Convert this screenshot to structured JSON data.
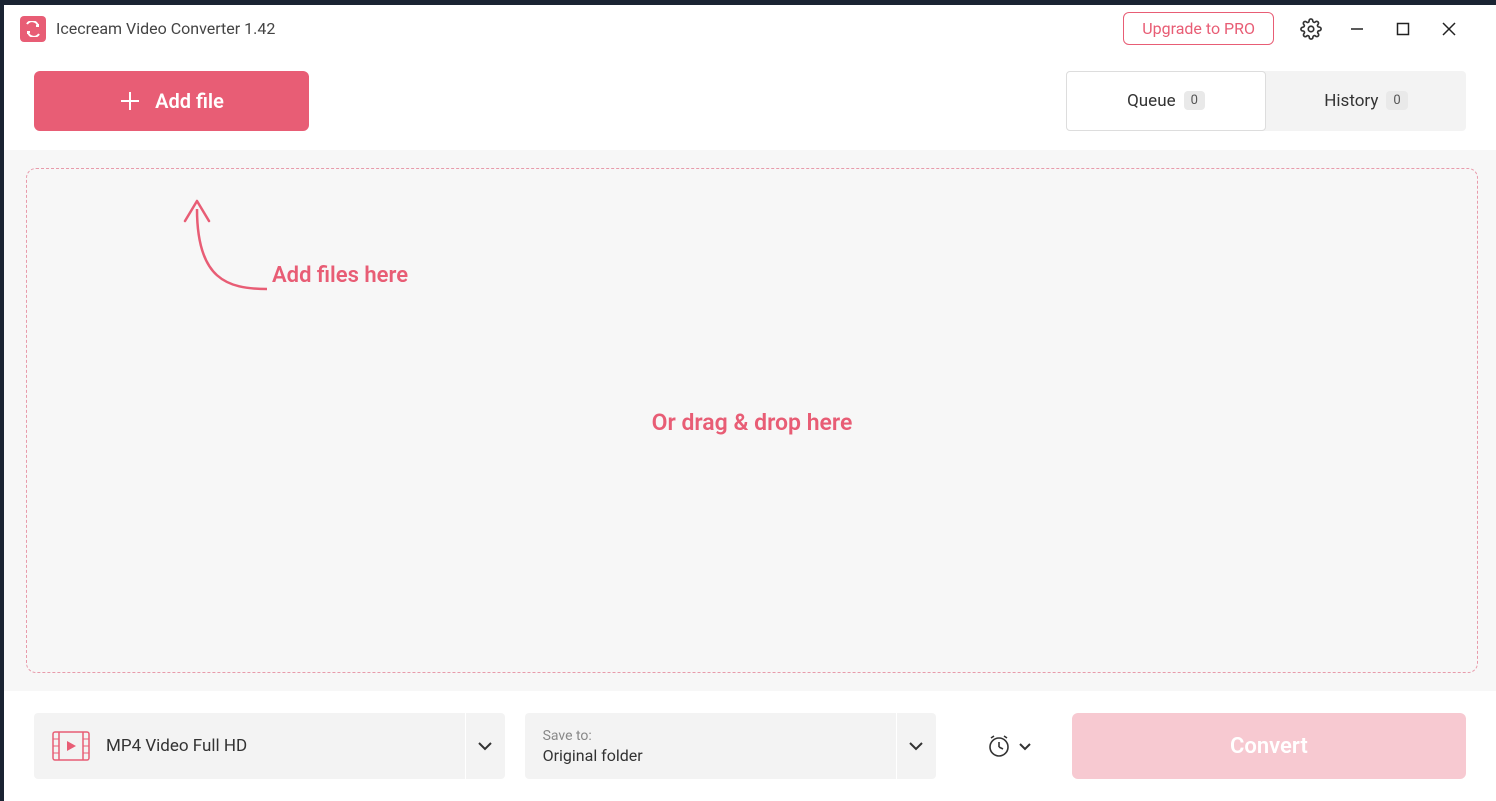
{
  "titlebar": {
    "app_title": "Icecream Video Converter 1.42",
    "upgrade_label": "Upgrade to PRO"
  },
  "toolbar": {
    "add_file_label": "Add file",
    "tabs": {
      "queue_label": "Queue",
      "queue_count": "0",
      "history_label": "History",
      "history_count": "0"
    }
  },
  "dropzone": {
    "hint1": "Add files here",
    "hint2": "Or drag & drop here"
  },
  "bottombar": {
    "format_label": "MP4 Video Full HD",
    "saveto_label": "Save to:",
    "saveto_value": "Original folder",
    "convert_label": "Convert"
  },
  "colors": {
    "accent": "#e85d75"
  }
}
